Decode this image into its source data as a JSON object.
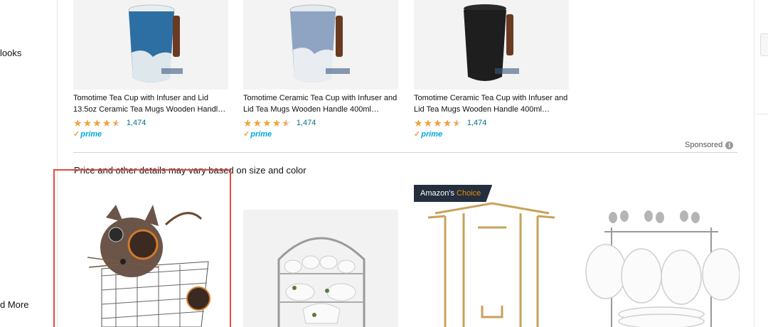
{
  "sidebar": {
    "item_partial_top": "looks",
    "item_partial_bottom": "d More"
  },
  "sponsored_products": [
    {
      "title": "Tomotime Tea Cup with Infuser and Lid 13.5oz Ceramic Tea Mugs Wooden Handl…",
      "rating": 4.5,
      "review_count": "1,474",
      "prime": "prime",
      "mug_color": "#2d6fa3"
    },
    {
      "title": "Tomotime Ceramic Tea Cup with Infuser and Lid Tea Mugs Wooden Handle 400ml…",
      "rating": 4.5,
      "review_count": "1,474",
      "prime": "prime",
      "mug_color": "#8fa4c2"
    },
    {
      "title": "Tomotime Ceramic Tea Cup with Infuser and Lid Tea Mugs Wooden Handle 400ml…",
      "rating": 4.5,
      "review_count": "1,474",
      "prime": "prime",
      "mug_color": "#1e1e1e"
    }
  ],
  "sponsored_label": "Sponsored",
  "notice": "Price and other details may vary based on size and color",
  "badge": {
    "brand": "Amazon's",
    "choice": "Choice"
  },
  "colors": {
    "star": "#f2a13b",
    "link": "#007185",
    "prime": "#00a8e1",
    "highlight": "#e04b45",
    "badge_bg": "#232f3e",
    "badge_choice": "#f08804"
  }
}
